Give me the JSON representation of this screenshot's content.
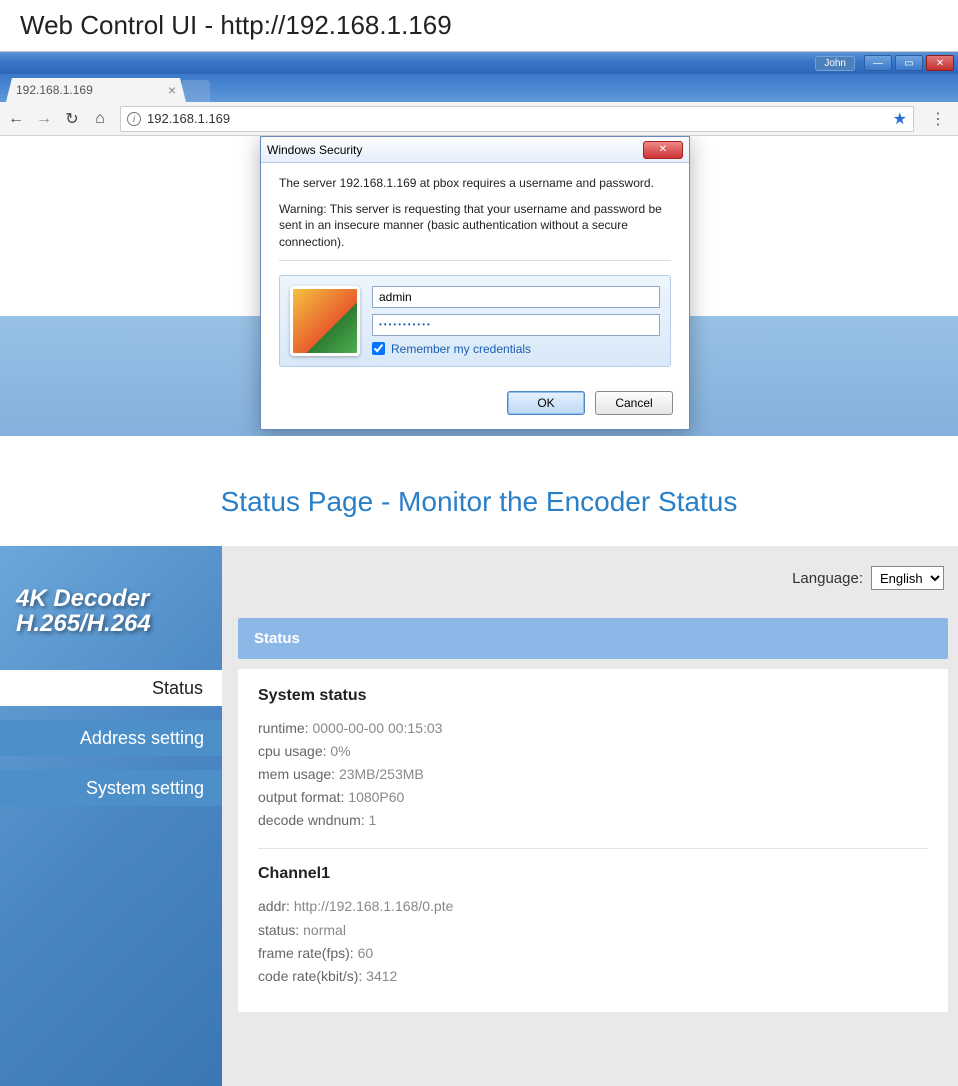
{
  "docHeading": "Web Control UI - http://192.168.1.169",
  "titlebar": {
    "user": "John"
  },
  "tab": {
    "title": "192.168.1.169"
  },
  "addressBar": {
    "url": "192.168.1.169"
  },
  "dialog": {
    "title": "Windows Security",
    "line1": "The server 192.168.1.169 at pbox requires a username and password.",
    "line2": "Warning: This server is requesting that your username and password be sent in an insecure manner (basic authentication without a secure connection).",
    "username": "admin",
    "passwordMasked": "•••••••••••",
    "rememberLabel": "Remember my credentials",
    "ok": "OK",
    "cancel": "Cancel"
  },
  "section2Title": "Status Page - Monitor the Encoder Status",
  "sidebar": {
    "logoLine1": "4K Decoder",
    "logoLine2": "H.265/H.264",
    "items": [
      "Status",
      "Address setting",
      "System setting"
    ]
  },
  "lang": {
    "label": "Language:",
    "selected": "English"
  },
  "panel": {
    "header": "Status"
  },
  "systemStatus": {
    "title": "System status",
    "rows": [
      {
        "k": "runtime:",
        "v": "0000-00-00 00:15:03"
      },
      {
        "k": "cpu usage:",
        "v": "0%"
      },
      {
        "k": "mem usage:",
        "v": "23MB/253MB"
      },
      {
        "k": "output format:",
        "v": "1080P60"
      },
      {
        "k": "decode wndnum:",
        "v": "1"
      }
    ]
  },
  "channel1": {
    "title": "Channel1",
    "rows": [
      {
        "k": "addr:",
        "v": "http://192.168.1.168/0.pte"
      },
      {
        "k": "status:",
        "v": "normal"
      },
      {
        "k": "frame rate(fps):",
        "v": "60"
      },
      {
        "k": "code rate(kbit/s):",
        "v": "3412"
      }
    ]
  }
}
